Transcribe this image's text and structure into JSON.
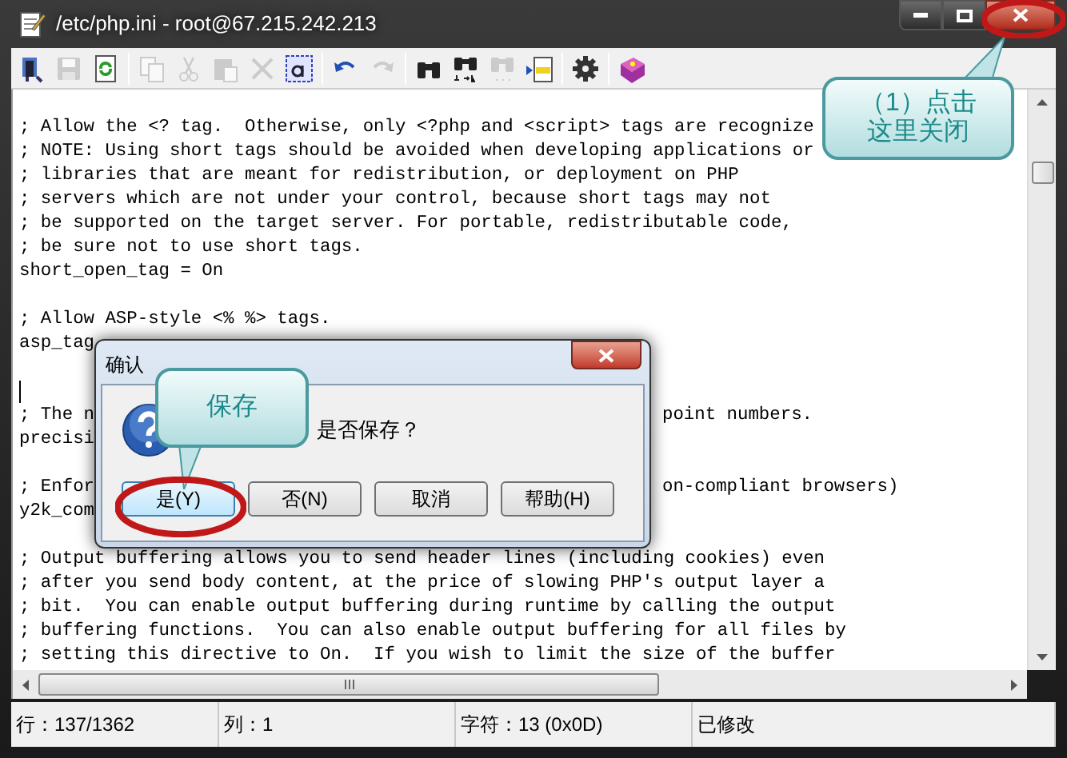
{
  "window": {
    "title": "/etc/php.ini - root@67.215.242.213"
  },
  "toolbar": [
    {
      "kind": "exit",
      "disabled": false
    },
    {
      "kind": "save",
      "disabled": true
    },
    {
      "kind": "reload",
      "disabled": false
    },
    {
      "kind": "separator"
    },
    {
      "kind": "copy",
      "disabled": true
    },
    {
      "kind": "cut",
      "disabled": true
    },
    {
      "kind": "paste",
      "disabled": true
    },
    {
      "kind": "delete",
      "disabled": true
    },
    {
      "kind": "select-all",
      "disabled": false
    },
    {
      "kind": "separator"
    },
    {
      "kind": "undo",
      "disabled": false
    },
    {
      "kind": "redo",
      "disabled": true
    },
    {
      "kind": "separator"
    },
    {
      "kind": "find",
      "disabled": false
    },
    {
      "kind": "replace",
      "disabled": false
    },
    {
      "kind": "find-next",
      "disabled": true
    },
    {
      "kind": "goto",
      "disabled": false
    },
    {
      "kind": "separator"
    },
    {
      "kind": "settings",
      "disabled": false
    },
    {
      "kind": "separator"
    },
    {
      "kind": "help",
      "disabled": false
    }
  ],
  "editor_lines": [
    {
      "kind": "code",
      "text": "; Allow the <? tag.  Otherwise, only <?php and <script> tags are recognize"
    },
    {
      "kind": "code",
      "text": "; NOTE: Using short tags should be avoided when developing applications or"
    },
    {
      "kind": "code",
      "text": "; libraries that are meant for redistribution, or deployment on PHP"
    },
    {
      "kind": "code",
      "text": "; servers which are not under your control, because short tags may not"
    },
    {
      "kind": "code",
      "text": "; be supported on the target server. For portable, redistributable code,"
    },
    {
      "kind": "code",
      "text": "; be sure not to use short tags."
    },
    {
      "kind": "code",
      "text": "short_open_tag = On"
    },
    {
      "kind": "blank"
    },
    {
      "kind": "code",
      "text": "; Allow ASP-style <% %> tags."
    },
    {
      "kind": "code",
      "text": "asp_tag"
    },
    {
      "kind": "blank"
    },
    {
      "kind": "caret"
    },
    {
      "kind": "code",
      "text": "; The n",
      "right": "point numbers."
    },
    {
      "kind": "code",
      "text": "precisi"
    },
    {
      "kind": "blank"
    },
    {
      "kind": "code",
      "text": "; Enfor",
      "right": "on-compliant browsers)"
    },
    {
      "kind": "code",
      "text": "y2k_com"
    },
    {
      "kind": "blank"
    },
    {
      "kind": "code",
      "text": "; Output buffering allows you to send header lines (including cookies) even"
    },
    {
      "kind": "code",
      "text": "; after you send body content, at the price of slowing PHP's output layer a"
    },
    {
      "kind": "code",
      "text": "; bit.  You can enable output buffering during runtime by calling the output"
    },
    {
      "kind": "code",
      "text": "; buffering functions.  You can also enable output buffering for all files by"
    },
    {
      "kind": "code",
      "text": "; setting this directive to On.  If you wish to limit the size of the buffer"
    }
  ],
  "status_bar": [
    "行：137/1362",
    "列：1",
    "字符：13 (0x0D)",
    "已修改"
  ],
  "dialog": {
    "title": "确认",
    "message": "是否保存？",
    "buttons": [
      {
        "label": "是(Y)",
        "focused": true
      },
      {
        "label": "否(N)",
        "focused": false
      },
      {
        "label": "取消",
        "focused": false
      },
      {
        "label": "帮助(H)",
        "focused": false
      }
    ]
  },
  "annotations": [
    {
      "kind": "callout",
      "lines": [
        "（1）点击",
        "这里关闭"
      ]
    },
    {
      "kind": "ellipse"
    },
    {
      "kind": "callout",
      "lines": [
        "保存"
      ]
    },
    {
      "kind": "ellipse"
    }
  ]
}
